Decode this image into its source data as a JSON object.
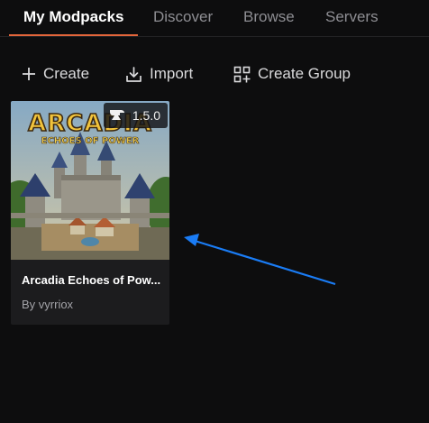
{
  "tabs": [
    {
      "label": "My Modpacks",
      "active": true
    },
    {
      "label": "Discover",
      "active": false
    },
    {
      "label": "Browse",
      "active": false
    },
    {
      "label": "Servers",
      "active": false
    }
  ],
  "toolbar": {
    "create_label": "Create",
    "import_label": "Import",
    "create_group_label": "Create Group"
  },
  "modpack": {
    "logo_line1": "ARCADIA",
    "logo_line2": "ECHOES OF POWER",
    "version": "1.5.0",
    "title": "Arcadia Echoes of Pow...",
    "author": "By vyrriox"
  },
  "colors": {
    "accent": "#e2653a",
    "annotation_arrow": "#1a7cf5",
    "background": "#0d0d0e",
    "card": "#1c1c1e"
  },
  "icons": [
    "plus-icon",
    "import-icon",
    "create-group-icon",
    "anvil-icon",
    "arrow-annotation"
  ]
}
